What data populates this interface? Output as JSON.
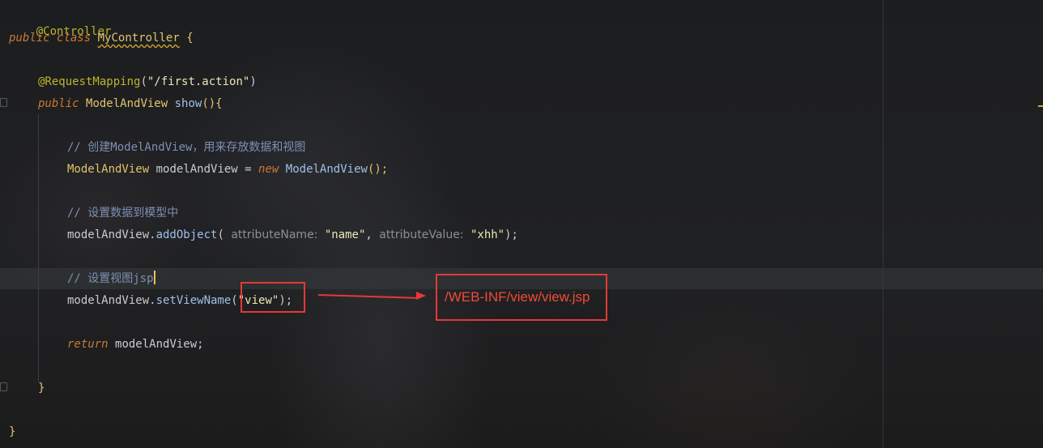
{
  "code": {
    "l1_annotation": "@Controller",
    "l2_kw_public": "public",
    "l2_kw_class": "class",
    "l2_class_name": "MyController",
    "l2_brace": "{",
    "l4_annotation": "@RequestMapping",
    "l4_paren_open": "(",
    "l4_string": "\"/first.action\"",
    "l4_paren_close": ")",
    "l5_kw_public": "public",
    "l5_type": "ModelAndView",
    "l5_method": "show",
    "l5_rest": "(){",
    "l7_comment": "// 创建ModelAndView，用来存放数据和视图",
    "l8_type": "ModelAndView",
    "l8_var": "modelAndView =",
    "l8_kw_new": "new",
    "l8_ctor": "ModelAndView",
    "l8_rest": "();",
    "l10_comment": "// 设置数据到模型中",
    "l11_obj": "modelAndView.",
    "l11_method": "addObject",
    "l11_paren_open": "(",
    "l11_hint_name": "attributeName:",
    "l11_arg_name": "\"name\"",
    "l11_comma": ",",
    "l11_hint_value": "attributeValue:",
    "l11_arg_value": "\"xhh\"",
    "l11_rest": ");",
    "l13_comment": "// 设置视图jsp",
    "l14_obj": "modelAndView.",
    "l14_method": "setViewName",
    "l14_paren_open": "(",
    "l14_arg": "\"view\"",
    "l14_rest": ");",
    "l16_kw_return": "return",
    "l16_rest": "modelAndView;",
    "l18_brace": "}",
    "l20_brace": "}"
  },
  "annotation": {
    "resolved_path": "/WEB-INF/view/view.jsp",
    "color": "#e53935"
  },
  "colors": {
    "background": "#1f2022",
    "keyword": "#cc7832",
    "annotation": "#bbb529",
    "class_name": "#e0c46c",
    "method": "#9fc0e6",
    "string": "#ece6b2",
    "comment": "#7e8fb3"
  }
}
